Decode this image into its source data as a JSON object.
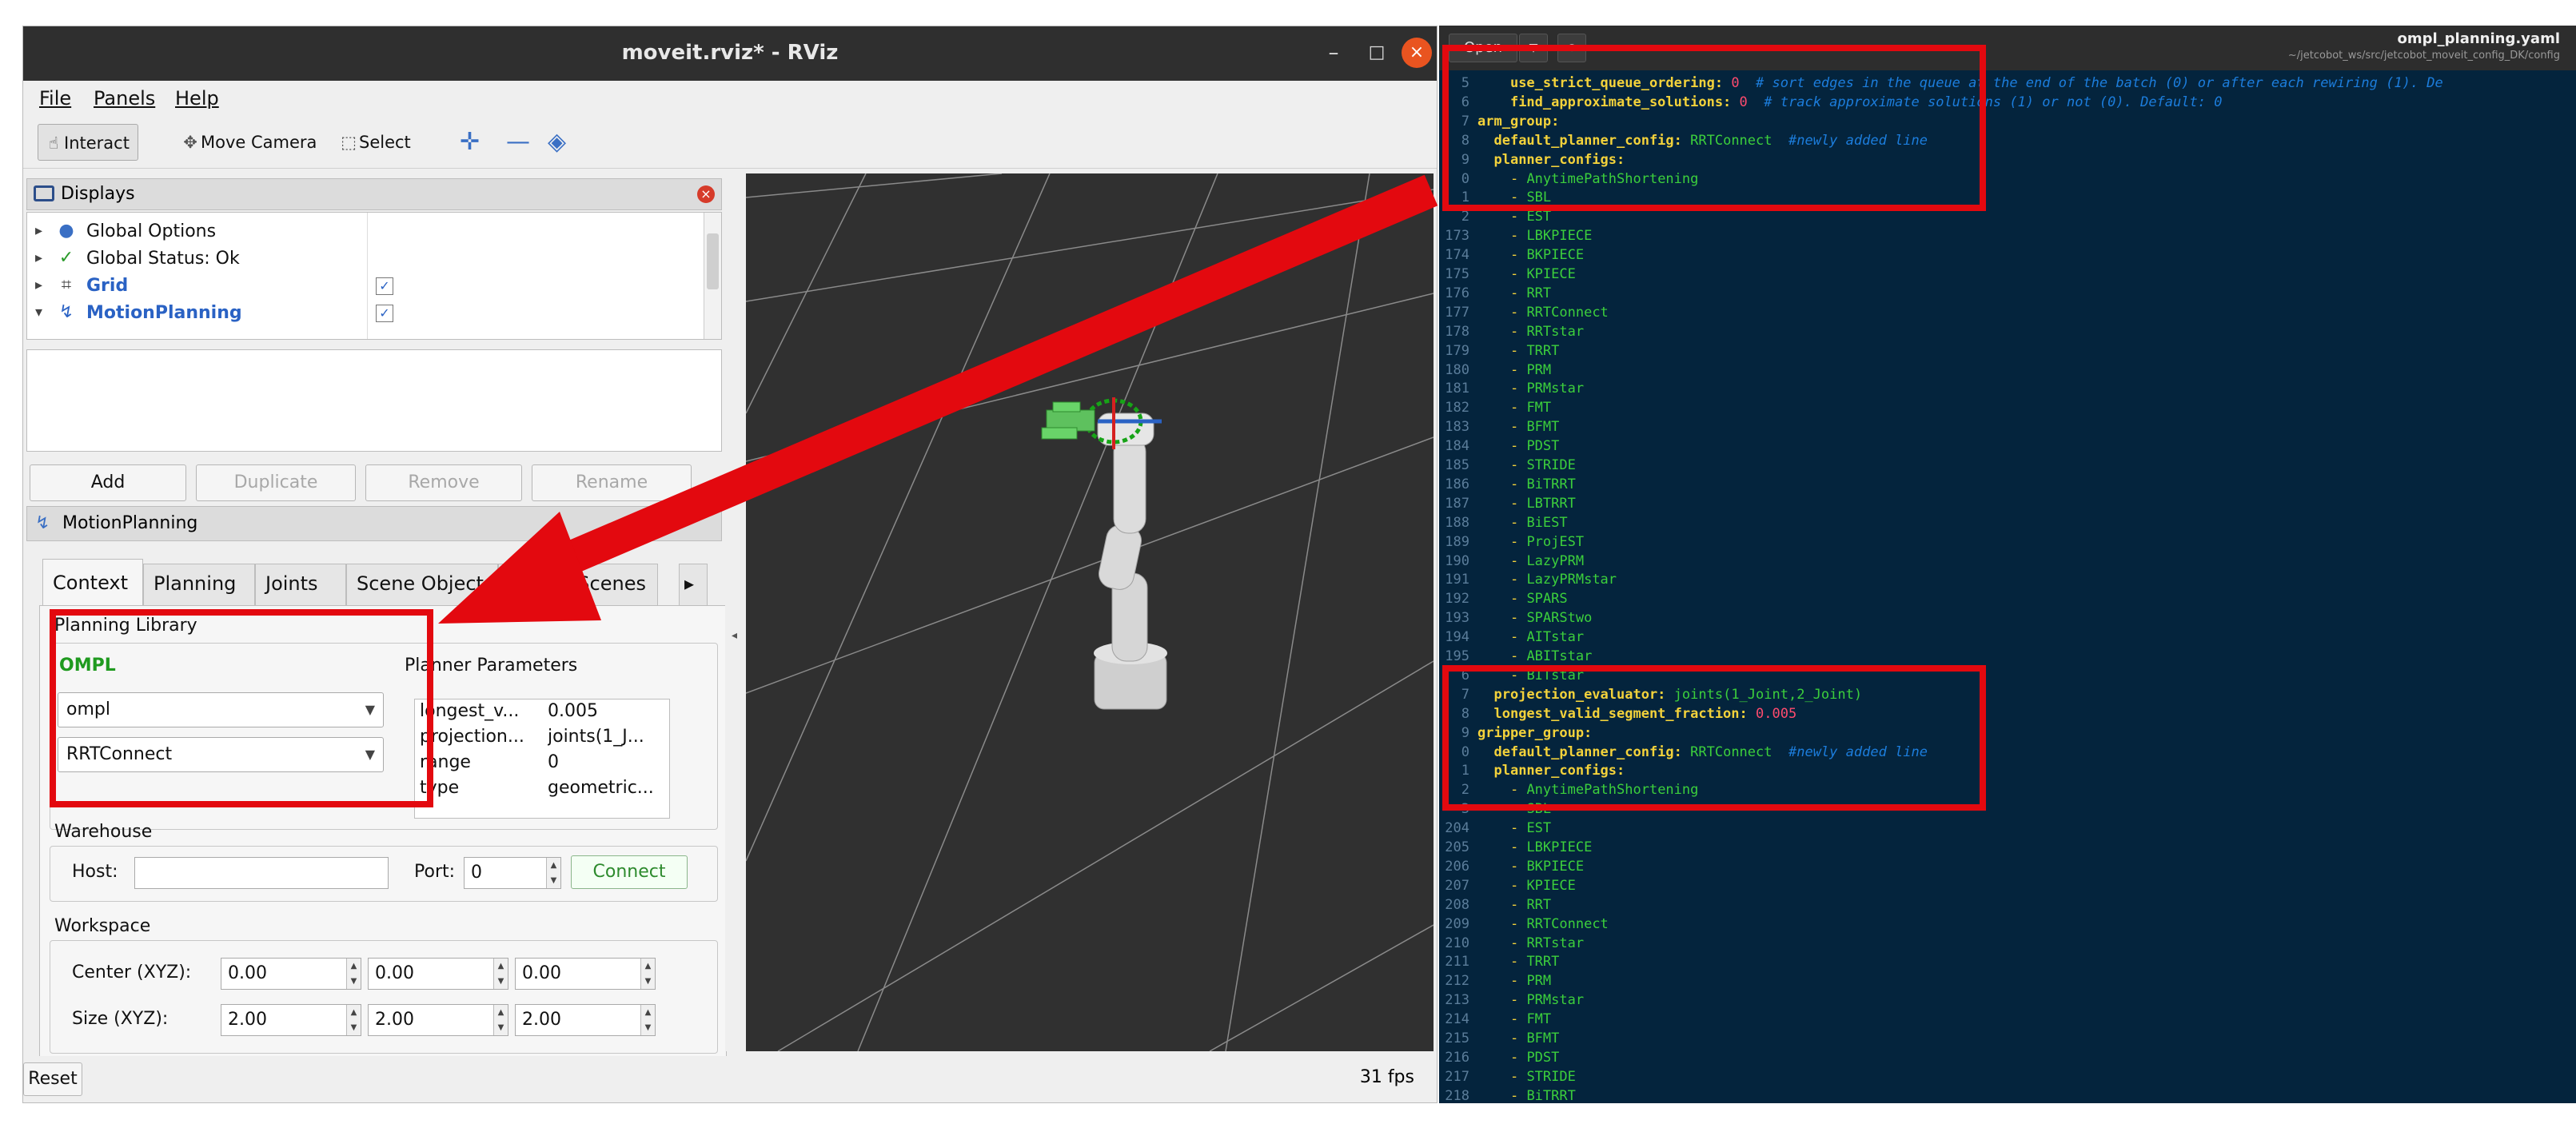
{
  "rviz": {
    "title": "moveit.rviz* - RViz",
    "window_buttons": {
      "minimize": "–",
      "maximize": "□",
      "close": "×"
    },
    "menu": [
      "File",
      "Panels",
      "Help"
    ],
    "toolbar": {
      "interact": "Interact",
      "move_camera": "Move Camera",
      "select": "Select",
      "focus_symbol": "✛",
      "measure_symbol": "—",
      "pose_symbol": "◈"
    },
    "displays": {
      "title": "Displays",
      "items": [
        {
          "label": "Global Options",
          "checked": null
        },
        {
          "label": "Global Status: Ok",
          "checked": null
        },
        {
          "label": "Grid",
          "checked": true
        },
        {
          "label": "MotionPlanning",
          "checked": true
        }
      ],
      "buttons": {
        "add": "Add",
        "duplicate": "Duplicate",
        "remove": "Remove",
        "rename": "Rename"
      }
    },
    "motion_planning": {
      "title": "MotionPlanning",
      "tabs": [
        "Context",
        "Planning",
        "Joints",
        "Scene Objects",
        "Stored Scenes"
      ],
      "planning_library_label": "Planning Library",
      "library_name": "OMPL",
      "library_value": "ompl",
      "planner_value": "RRTConnect",
      "planner_params_label": "Planner Parameters",
      "planner_params": [
        {
          "key": "longest_v...",
          "value": "0.005"
        },
        {
          "key": "projection...",
          "value": "joints(1_J..."
        },
        {
          "key": "range",
          "value": "0"
        },
        {
          "key": "type",
          "value": "geometric..."
        }
      ],
      "warehouse_label": "Warehouse",
      "host_label": "Host:",
      "host_value": "",
      "port_label": "Port:",
      "port_value": "0",
      "connect": "Connect",
      "workspace_label": "Workspace",
      "center_label": "Center (XYZ):",
      "center": [
        "0.00",
        "0.00",
        "0.00"
      ],
      "size_label": "Size (XYZ):",
      "size": [
        "2.00",
        "2.00",
        "2.00"
      ]
    },
    "reset": "Reset",
    "fps": "31 fps"
  },
  "editor": {
    "open": "Open",
    "filename": "ompl_planning.yaml",
    "path": "~/jetcobot_ws/src/jetcobot_moveit_config_DK/config",
    "colors": {
      "bg": "#04243d",
      "key": "#f3d23b",
      "value": "#3ccf3c",
      "number": "#ff4b6e",
      "comment": "#1c7ddc"
    },
    "lines": [
      {
        "n": "5",
        "k": "use_strict_queue_ordering:",
        "num": "0",
        "c": "# sort edges in the queue at the end of the batch (0) or after each rewiring (1). De",
        "indent": 2
      },
      {
        "n": "6",
        "k": "find_approximate_solutions:",
        "num": "0",
        "c": "# track approximate solutions (1) or not (0). Default: 0",
        "indent": 2
      },
      {
        "n": "7",
        "k": "arm_group:",
        "indent": 0
      },
      {
        "n": "8",
        "k": "default_planner_config:",
        "v": "RRTConnect",
        "c": "#newly added line",
        "indent": 1
      },
      {
        "n": "9",
        "k": "planner_configs:",
        "indent": 1
      },
      {
        "n": "0",
        "item": "AnytimePathShortening",
        "indent": 2
      },
      {
        "n": "1",
        "item": "SBL",
        "indent": 2
      },
      {
        "n": "2",
        "item": "EST",
        "indent": 2
      },
      {
        "n": "173",
        "item": "LBKPIECE",
        "indent": 2
      },
      {
        "n": "174",
        "item": "BKPIECE",
        "indent": 2
      },
      {
        "n": "175",
        "item": "KPIECE",
        "indent": 2
      },
      {
        "n": "176",
        "item": "RRT",
        "indent": 2
      },
      {
        "n": "177",
        "item": "RRTConnect",
        "indent": 2
      },
      {
        "n": "178",
        "item": "RRTstar",
        "indent": 2
      },
      {
        "n": "179",
        "item": "TRRT",
        "indent": 2
      },
      {
        "n": "180",
        "item": "PRM",
        "indent": 2
      },
      {
        "n": "181",
        "item": "PRMstar",
        "indent": 2
      },
      {
        "n": "182",
        "item": "FMT",
        "indent": 2
      },
      {
        "n": "183",
        "item": "BFMT",
        "indent": 2
      },
      {
        "n": "184",
        "item": "PDST",
        "indent": 2
      },
      {
        "n": "185",
        "item": "STRIDE",
        "indent": 2
      },
      {
        "n": "186",
        "item": "BiTRRT",
        "indent": 2
      },
      {
        "n": "187",
        "item": "LBTRRT",
        "indent": 2
      },
      {
        "n": "188",
        "item": "BiEST",
        "indent": 2
      },
      {
        "n": "189",
        "item": "ProjEST",
        "indent": 2
      },
      {
        "n": "190",
        "item": "LazyPRM",
        "indent": 2
      },
      {
        "n": "191",
        "item": "LazyPRMstar",
        "indent": 2
      },
      {
        "n": "192",
        "item": "SPARS",
        "indent": 2
      },
      {
        "n": "193",
        "item": "SPARStwo",
        "indent": 2
      },
      {
        "n": "194",
        "item": "AITstar",
        "indent": 2
      },
      {
        "n": "195",
        "item": "ABITstar",
        "indent": 2
      },
      {
        "n": "6",
        "item": "BITstar",
        "indent": 2
      },
      {
        "n": "7",
        "k": "projection_evaluator:",
        "v": "joints(1_Joint,2_Joint)",
        "indent": 1
      },
      {
        "n": "8",
        "k": "longest_valid_segment_fraction:",
        "num": "0.005",
        "indent": 1
      },
      {
        "n": "9",
        "k": "gripper_group:",
        "indent": 0
      },
      {
        "n": "0",
        "k": "default_planner_config:",
        "v": "RRTConnect",
        "c": "#newly added line",
        "indent": 1
      },
      {
        "n": "1",
        "k": "planner_configs:",
        "indent": 1
      },
      {
        "n": "2",
        "item": "AnytimePathShortening",
        "indent": 2
      },
      {
        "n": "3",
        "item": "SBL",
        "indent": 2
      },
      {
        "n": "204",
        "item": "EST",
        "indent": 2
      },
      {
        "n": "205",
        "item": "LBKPIECE",
        "indent": 2
      },
      {
        "n": "206",
        "item": "BKPIECE",
        "indent": 2
      },
      {
        "n": "207",
        "item": "KPIECE",
        "indent": 2
      },
      {
        "n": "208",
        "item": "RRT",
        "indent": 2
      },
      {
        "n": "209",
        "item": "RRTConnect",
        "indent": 2
      },
      {
        "n": "210",
        "item": "RRTstar",
        "indent": 2
      },
      {
        "n": "211",
        "item": "TRRT",
        "indent": 2
      },
      {
        "n": "212",
        "item": "PRM",
        "indent": 2
      },
      {
        "n": "213",
        "item": "PRMstar",
        "indent": 2
      },
      {
        "n": "214",
        "item": "FMT",
        "indent": 2
      },
      {
        "n": "215",
        "item": "BFMT",
        "indent": 2
      },
      {
        "n": "216",
        "item": "PDST",
        "indent": 2
      },
      {
        "n": "217",
        "item": "STRIDE",
        "indent": 2
      },
      {
        "n": "218",
        "item": "BiTRRT",
        "indent": 2
      }
    ]
  },
  "annotation_color": "#e3090f"
}
